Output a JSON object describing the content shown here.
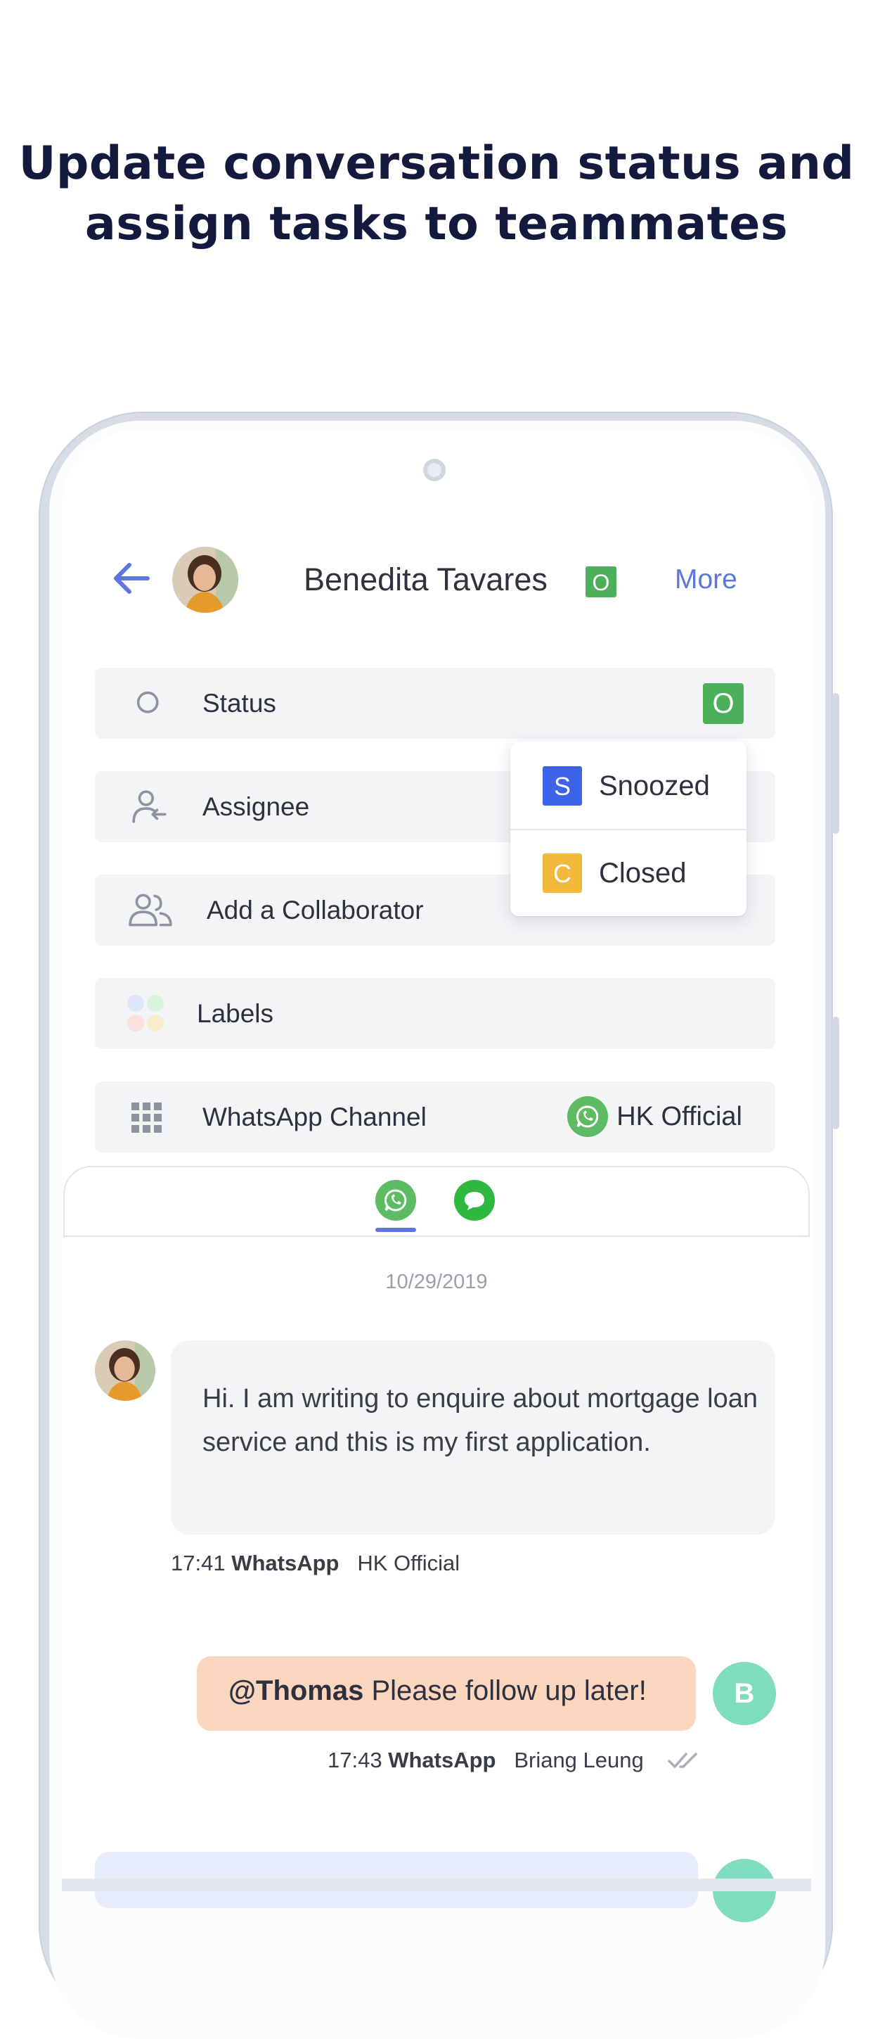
{
  "headline": {
    "line1": "Update conversation status and",
    "line2": "assign tasks to teammates"
  },
  "header": {
    "contact_name": "Benedita Tavares",
    "status_letter": "O",
    "more_label": "More"
  },
  "details": {
    "status": {
      "label": "Status",
      "value": "O"
    },
    "assignee": {
      "label": "Assignee"
    },
    "collaborator": {
      "label": "Add a Collaborator"
    },
    "labels": {
      "label": "Labels"
    },
    "channel": {
      "label": "WhatsApp Channel",
      "value": "HK Official"
    }
  },
  "status_menu": {
    "options": [
      {
        "letter": "S",
        "label": "Snoozed",
        "color": "#3d63e8"
      },
      {
        "letter": "C",
        "label": "Closed",
        "color": "#f0b93a"
      }
    ]
  },
  "conversation": {
    "date": "10/29/2019",
    "messages": [
      {
        "text": "Hi. I am writing to enquire about mortgage loan service and this is my first application.",
        "time": "17:41",
        "channel": "WhatsApp",
        "account": "HK Official"
      },
      {
        "mention": "@Thomas",
        "text": " Please follow up later!",
        "time": "17:43",
        "channel": "WhatsApp",
        "sender": "Briang Leung",
        "avatar_letter": "B"
      }
    ]
  },
  "colors": {
    "accent": "#5e75e0",
    "open_status": "#4caf5a",
    "whatsapp": "#5dbb63",
    "note_bubble": "#f9d6bd"
  }
}
